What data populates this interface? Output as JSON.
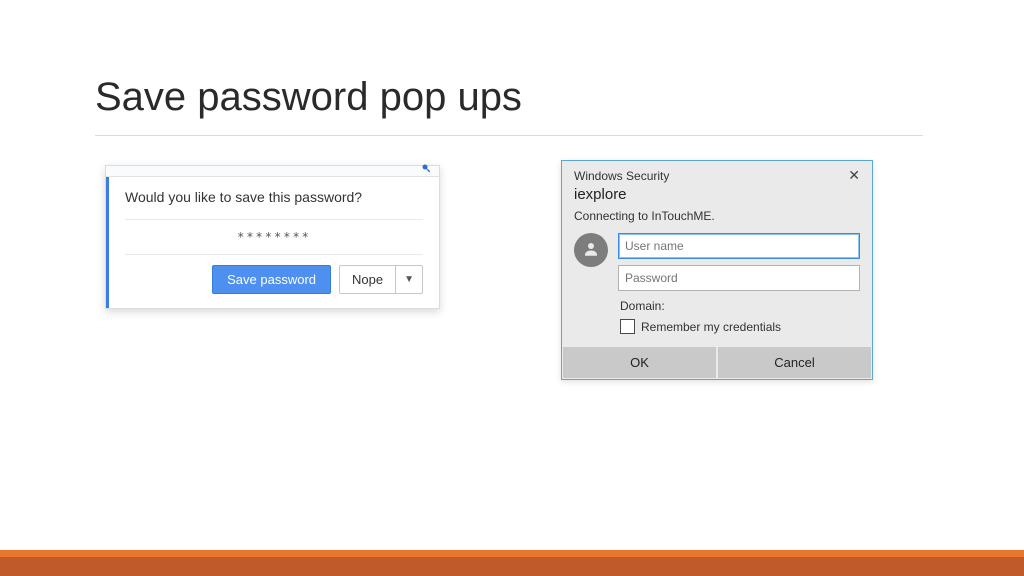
{
  "slide": {
    "title": "Save password pop ups"
  },
  "chrome": {
    "question": "Would you like to save this password?",
    "masked_password": "********",
    "save_label": "Save password",
    "nope_label": "Nope"
  },
  "winsec": {
    "titlebar": "Windows Security",
    "heading": "iexplore",
    "subtext": "Connecting to InTouchME.",
    "username_placeholder": "User name",
    "password_placeholder": "Password",
    "domain_label": "Domain:",
    "remember_label": "Remember my credentials",
    "ok_label": "OK",
    "cancel_label": "Cancel"
  }
}
